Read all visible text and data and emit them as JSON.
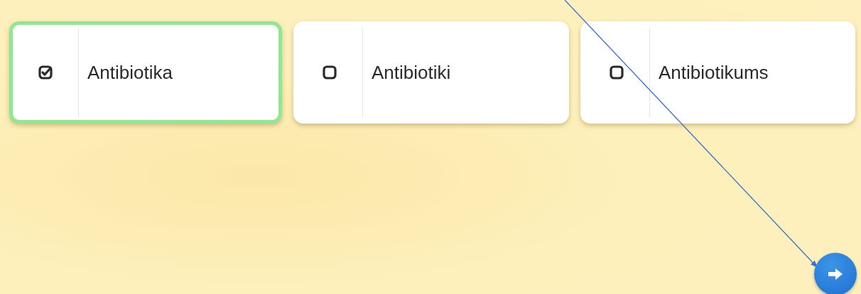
{
  "options": [
    {
      "label": "Antibiotika",
      "checked": true
    },
    {
      "label": "Antibiotiki",
      "checked": false
    },
    {
      "label": "Antibiotikums",
      "checked": false
    }
  ]
}
